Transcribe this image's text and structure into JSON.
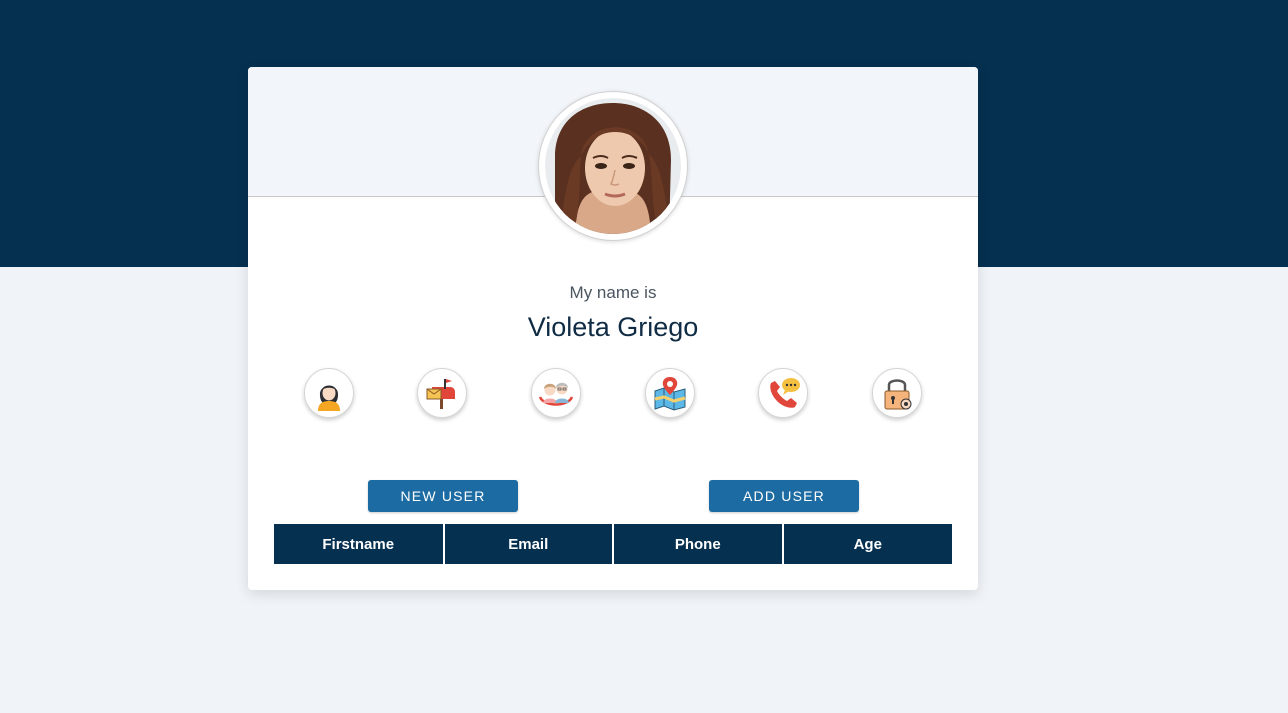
{
  "profile": {
    "intro_label": "My name is",
    "name": "Violeta Griego"
  },
  "icons": [
    {
      "name": "user-icon"
    },
    {
      "name": "mailbox-icon"
    },
    {
      "name": "age-icon"
    },
    {
      "name": "map-icon"
    },
    {
      "name": "phone-icon"
    },
    {
      "name": "lock-icon"
    }
  ],
  "buttons": {
    "new_user": "NEW USER",
    "add_user": "ADD USER"
  },
  "table": {
    "columns": [
      "Firstname",
      "Email",
      "Phone",
      "Age"
    ]
  },
  "colors": {
    "header_band": "#063050",
    "button": "#1d6ba3",
    "background": "#f0f4f8"
  }
}
